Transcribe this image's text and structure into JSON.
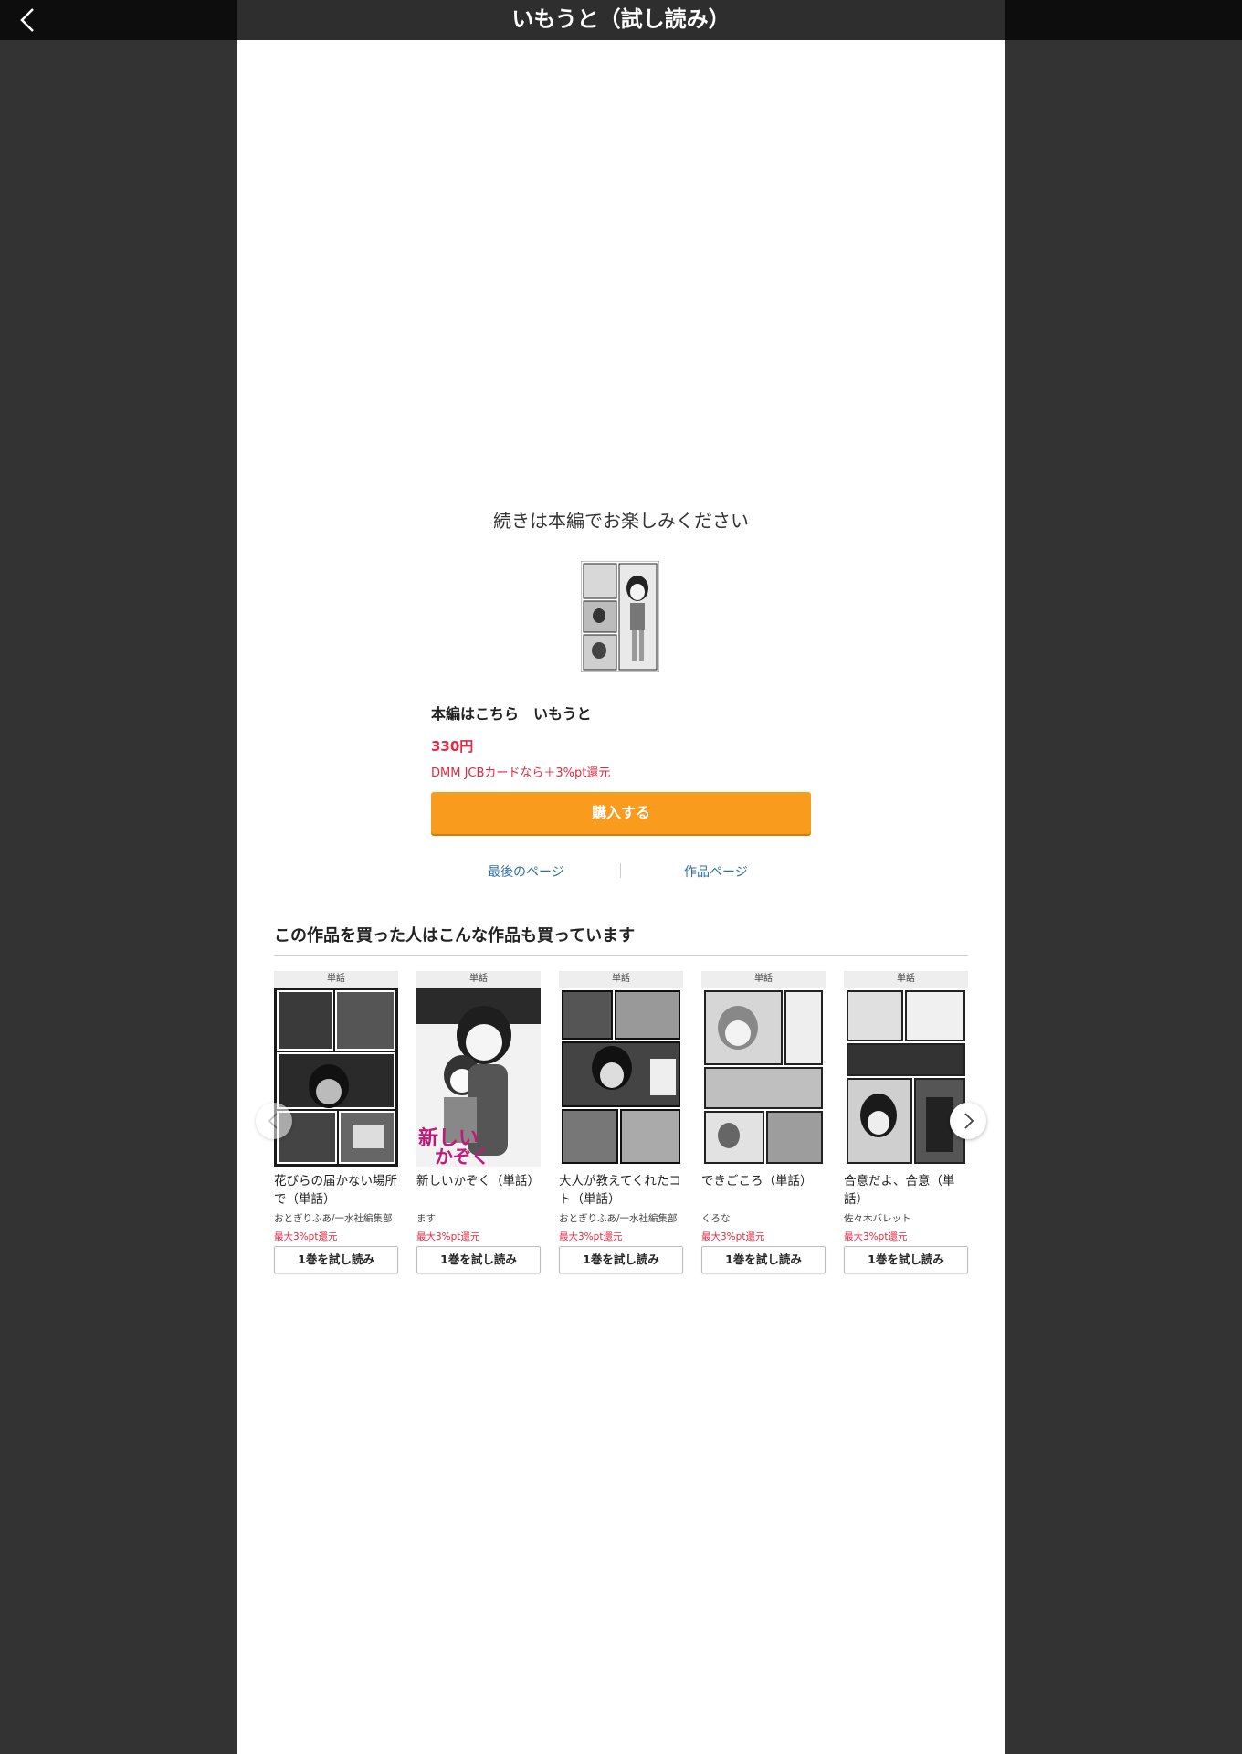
{
  "header": {
    "title": "いもうと（試し読み）"
  },
  "end_panel": {
    "continue_text": "続きは本編でお楽しみください",
    "main_title": "本編はこちら　いもうと",
    "price": "330円",
    "jcb_note": "DMM JCBカードなら＋3%pt還元",
    "buy_label": "購入する",
    "last_page_label": "最後のページ",
    "work_page_label": "作品ページ"
  },
  "recommendations": {
    "heading": "この作品を買った人はこんな作品も買っています",
    "items": [
      {
        "tag": "単話",
        "title": "花びらの届かない場所で（単話）",
        "author": "おとぎりふあ/一水社編集部",
        "points": "最大3%pt還元",
        "button": "1巻を試し読み"
      },
      {
        "tag": "単話",
        "title": "新しいかぞく（単話）",
        "author": "ます",
        "points": "最大3%pt還元",
        "button": "1巻を試し読み"
      },
      {
        "tag": "単話",
        "title": "大人が教えてくれたコト（単話）",
        "author": "おとぎりふあ/一水社編集部",
        "points": "最大3%pt還元",
        "button": "1巻を試し読み"
      },
      {
        "tag": "単話",
        "title": "できごころ（単話）",
        "author": "くろな",
        "points": "最大3%pt還元",
        "button": "1巻を試し読み"
      },
      {
        "tag": "単話",
        "title": "合意だよ、合意（単話）",
        "author": "佐々木バレット",
        "points": "最大3%pt還元",
        "button": "1巻を試し読み"
      }
    ]
  },
  "colors": {
    "accent_orange": "#f99b1c",
    "price_red": "#e5283f",
    "link_blue": "#2f6fa1"
  }
}
